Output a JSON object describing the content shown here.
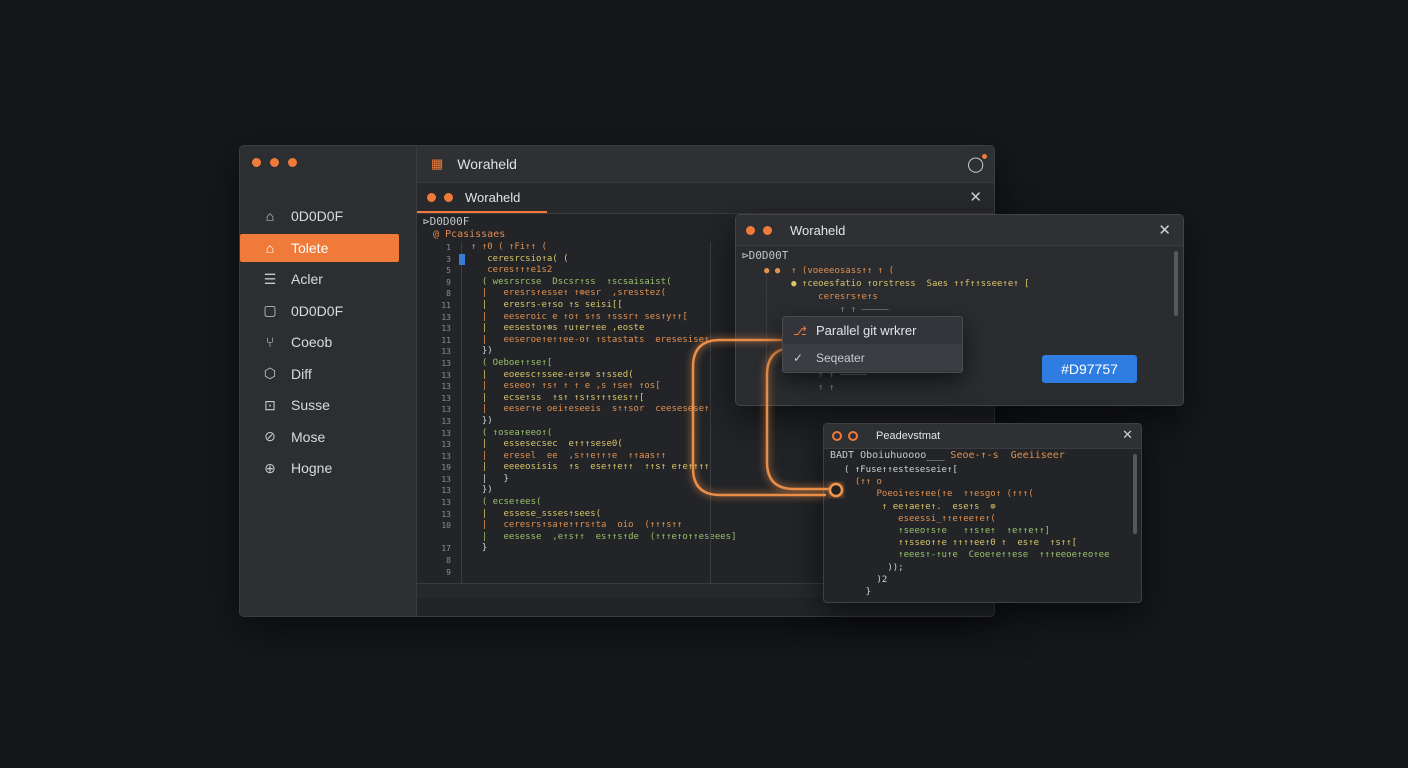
{
  "main_window": {
    "sidebar": {
      "items": [
        {
          "label": "0D0D0F",
          "icon": "home-icon"
        },
        {
          "label": "Tolete",
          "icon": "tag-icon",
          "active": true
        },
        {
          "label": "Acler",
          "icon": "list-icon"
        },
        {
          "label": "0D0D0F",
          "icon": "square-icon"
        },
        {
          "label": "Coeob",
          "icon": "branch-icon"
        },
        {
          "label": "Diff",
          "icon": "diff-icon"
        },
        {
          "label": "Susse",
          "icon": "terminal-icon"
        },
        {
          "label": "Mose",
          "icon": "compass-icon"
        },
        {
          "label": "Hogne",
          "icon": "history-icon"
        }
      ]
    },
    "editor": {
      "title": "Woraheld",
      "tab_label": "Woraheld",
      "file_path": "⊳D0D00F",
      "file_sub": "@ Pcasissaes",
      "line_numbers": [
        "1",
        "3",
        "5",
        "9",
        "8",
        "11",
        "13",
        "13",
        "11",
        "13",
        "13",
        "13",
        "13",
        "13",
        "13",
        "13",
        "13",
        "13",
        "13",
        "19",
        "13",
        "13",
        "13",
        "13",
        "10",
        "",
        "17",
        "8",
        "9"
      ],
      "code_lines": [
        {
          "t": "↑ ↑0 ( ↑Fi↑↑ (",
          "c": "c-o"
        },
        {
          "t": "   ceresrcsio↑a( (",
          "c": "c-y"
        },
        {
          "t": "   ceres↑↑↑e1s2",
          "c": "c-o"
        },
        {
          "t": "  ( wesrsrcse  Dscsr↑ss  ↑scsaisaist(",
          "c": "c-g"
        },
        {
          "t": "  |   eresrs↑esse↑ ↑⊕esr  ,sresstez(",
          "c": "c-o"
        },
        {
          "t": "  |   eresrs-e↑so ↑s seisi[[",
          "c": "c-y"
        },
        {
          "t": "  |   eeseroic e ↑o↑ s↑s ↑sssr↑ ses↑y↑↑[",
          "c": "c-o"
        },
        {
          "t": "  |   eesesto↑⊕s ↑u↑er↑ee ,eoste",
          "c": "c-y"
        },
        {
          "t": "  |   eeseroe↑e↑↑ee-o↑ ↑stastats  eresesise↑",
          "c": "c-o"
        },
        {
          "t": "  })",
          "c": "c-w"
        },
        {
          "t": "  ( Oeboe↑↑se↑[",
          "c": "c-g"
        },
        {
          "t": "  |   eoeesc↑ssee-e↑s⊕ s↑ssed(",
          "c": "c-y"
        },
        {
          "t": "  |   eseeo↑ ↑s↑ ↑ ↑ e ,s ↑se↑ ↑os[",
          "c": "c-o"
        },
        {
          "t": "  |   ecse↑ss  ↑s↑ ↑s↑s↑↑↑ses↑↑[",
          "c": "c-y"
        },
        {
          "t": "  |   eeser↑e oei↑eseeis  s↑↑sor  ceesesese↑",
          "c": "c-o"
        },
        {
          "t": "  })",
          "c": "c-w"
        },
        {
          "t": "  ( ↑osea↑eeo↑(",
          "c": "c-g"
        },
        {
          "t": "  |   essesecsec  e↑↑↑sese0(",
          "c": "c-y"
        },
        {
          "t": "  |   eresel  ee  ,s↑↑e↑↑↑e  ↑↑aas↑↑",
          "c": "c-o"
        },
        {
          "t": "  |   eeeeosisis  ↑s  ese↑↑e↑↑  ↑↑s↑ e↑e↑↑↑↑",
          "c": "c-y"
        },
        {
          "t": "  |   }",
          "c": "c-w"
        },
        {
          "t": "  })",
          "c": "c-w"
        },
        {
          "t": "  ( ecse↑ees(",
          "c": "c-g"
        },
        {
          "t": "  |   essese_ssses↑sees(",
          "c": "c-y"
        },
        {
          "t": "  |   ceresrs↑sa↑e↑↑rs↑ta  oio  (↑↑↑s↑↑",
          "c": "c-o"
        },
        {
          "t": "  |   eesesse  ,e↑s↑↑  es↑↑s↑de  (↑↑↑e↑o↑↑eseees]",
          "c": "c-g"
        },
        {
          "t": "  }",
          "c": "c-w"
        }
      ]
    }
  },
  "popup_window": {
    "title": "Woraheld",
    "file_path": "⊳D0D00T",
    "code_lines": [
      {
        "t": "● ●  ↑ (voeeeosass↑↑ ↑ (",
        "c": "c-o"
      },
      {
        "t": "     ● ↑ceoesfatio ↑orstress  Saes ↑↑f↑↑ssee↑e↑ [",
        "c": "c-y"
      },
      {
        "t": "          ceresrs↑e↑s",
        "c": "c-o"
      },
      {
        "t": "              ↑ ↑ —————",
        "c": "c-d"
      },
      {
        "t": "",
        "c": "c-d"
      },
      {
        "t": "",
        "c": "c-d"
      },
      {
        "t": "",
        "c": "c-d"
      },
      {
        "t": "",
        "c": "c-d"
      },
      {
        "t": "          ↑ ↑ —————",
        "c": "c-d"
      },
      {
        "t": "          ↑ ↑",
        "c": "c-d"
      }
    ],
    "color_badge": "#D97757"
  },
  "context_menu": {
    "items": [
      {
        "label": "Parallel git wrkrer",
        "icon": "branch-icon"
      },
      {
        "label": "Seqeater",
        "icon": "check-icon"
      }
    ]
  },
  "bottom_window": {
    "title": "Peadevstmat",
    "header_left": "BADT Oboiuhuoooo___",
    "header_right": "Seoe-↑-s  Geeiiseer",
    "code_lines": [
      {
        "t": "( ↑Fuse↑↑esteseseie↑[",
        "c": "c-w"
      },
      {
        "t": "  (↑↑ o",
        "c": "c-o"
      },
      {
        "t": "      Poeoi↑es↑ee(↑e  ↑↑esgo↑ (↑↑↑(",
        "c": "c-o"
      },
      {
        "t": "       ↑ ee↑ae↑e↑.  ese↑s  ⊕",
        "c": "c-y"
      },
      {
        "t": "          eseessi_↑↑e↑ee↑e↑(",
        "c": "c-o"
      },
      {
        "t": "          ↑seeo↑s↑e   ↑↑s↑e↑  ↑e↑↑e↑↑]",
        "c": "c-g"
      },
      {
        "t": "          ↑↑sseo↑↑e ↑↑↑↑ee↑0 ↑  es↑e  ↑s↑↑[",
        "c": "c-y"
      },
      {
        "t": "          ↑eees↑-↑u↑e  Ceoe↑e↑↑ese  ↑↑↑eeoe↑eo↑ee",
        "c": "c-g"
      },
      {
        "t": "        ));",
        "c": "c-w"
      },
      {
        "t": "      )2",
        "c": "c-w"
      },
      {
        "t": "    }",
        "c": "c-w"
      }
    ]
  },
  "colors": {
    "accent": "#f07a3a",
    "badge": "#2f7de1",
    "background": "#15171b"
  }
}
